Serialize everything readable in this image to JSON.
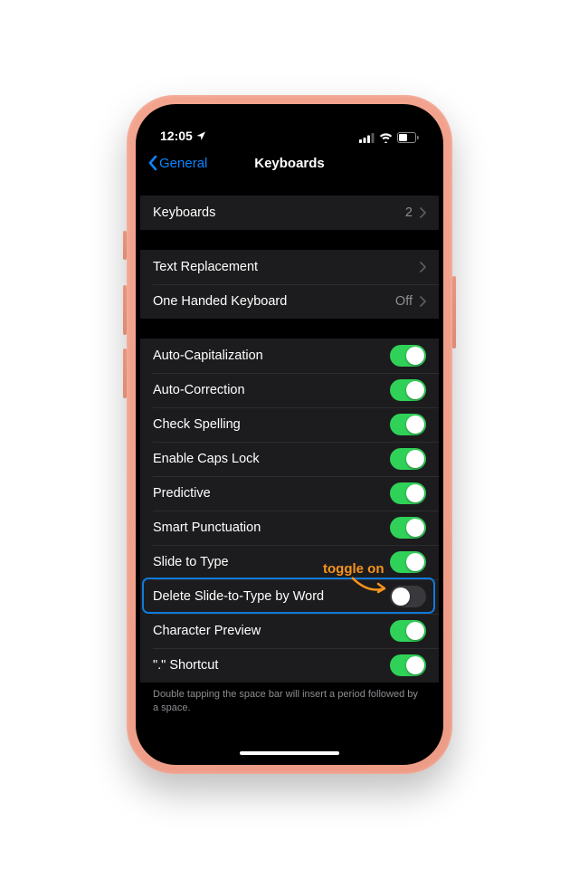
{
  "status": {
    "time": "12:05",
    "location_icon": "location-arrow"
  },
  "nav": {
    "back_label": "General",
    "title": "Keyboards"
  },
  "group1": {
    "keyboards": {
      "label": "Keyboards",
      "value": "2"
    }
  },
  "group2": {
    "text_replacement": {
      "label": "Text Replacement"
    },
    "one_handed": {
      "label": "One Handed Keyboard",
      "value": "Off"
    }
  },
  "group3": {
    "items": [
      {
        "label": "Auto-Capitalization",
        "on": true
      },
      {
        "label": "Auto-Correction",
        "on": true
      },
      {
        "label": "Check Spelling",
        "on": true
      },
      {
        "label": "Enable Caps Lock",
        "on": true
      },
      {
        "label": "Predictive",
        "on": true
      },
      {
        "label": "Smart Punctuation",
        "on": true
      },
      {
        "label": "Slide to Type",
        "on": true
      },
      {
        "label": "Delete Slide-to-Type by Word",
        "on": false
      },
      {
        "label": "Character Preview",
        "on": true
      },
      {
        "label": "\".\" Shortcut",
        "on": true
      }
    ],
    "footer": "Double tapping the space bar will insert a period followed by a space."
  },
  "annotation": {
    "text": "toggle on"
  }
}
